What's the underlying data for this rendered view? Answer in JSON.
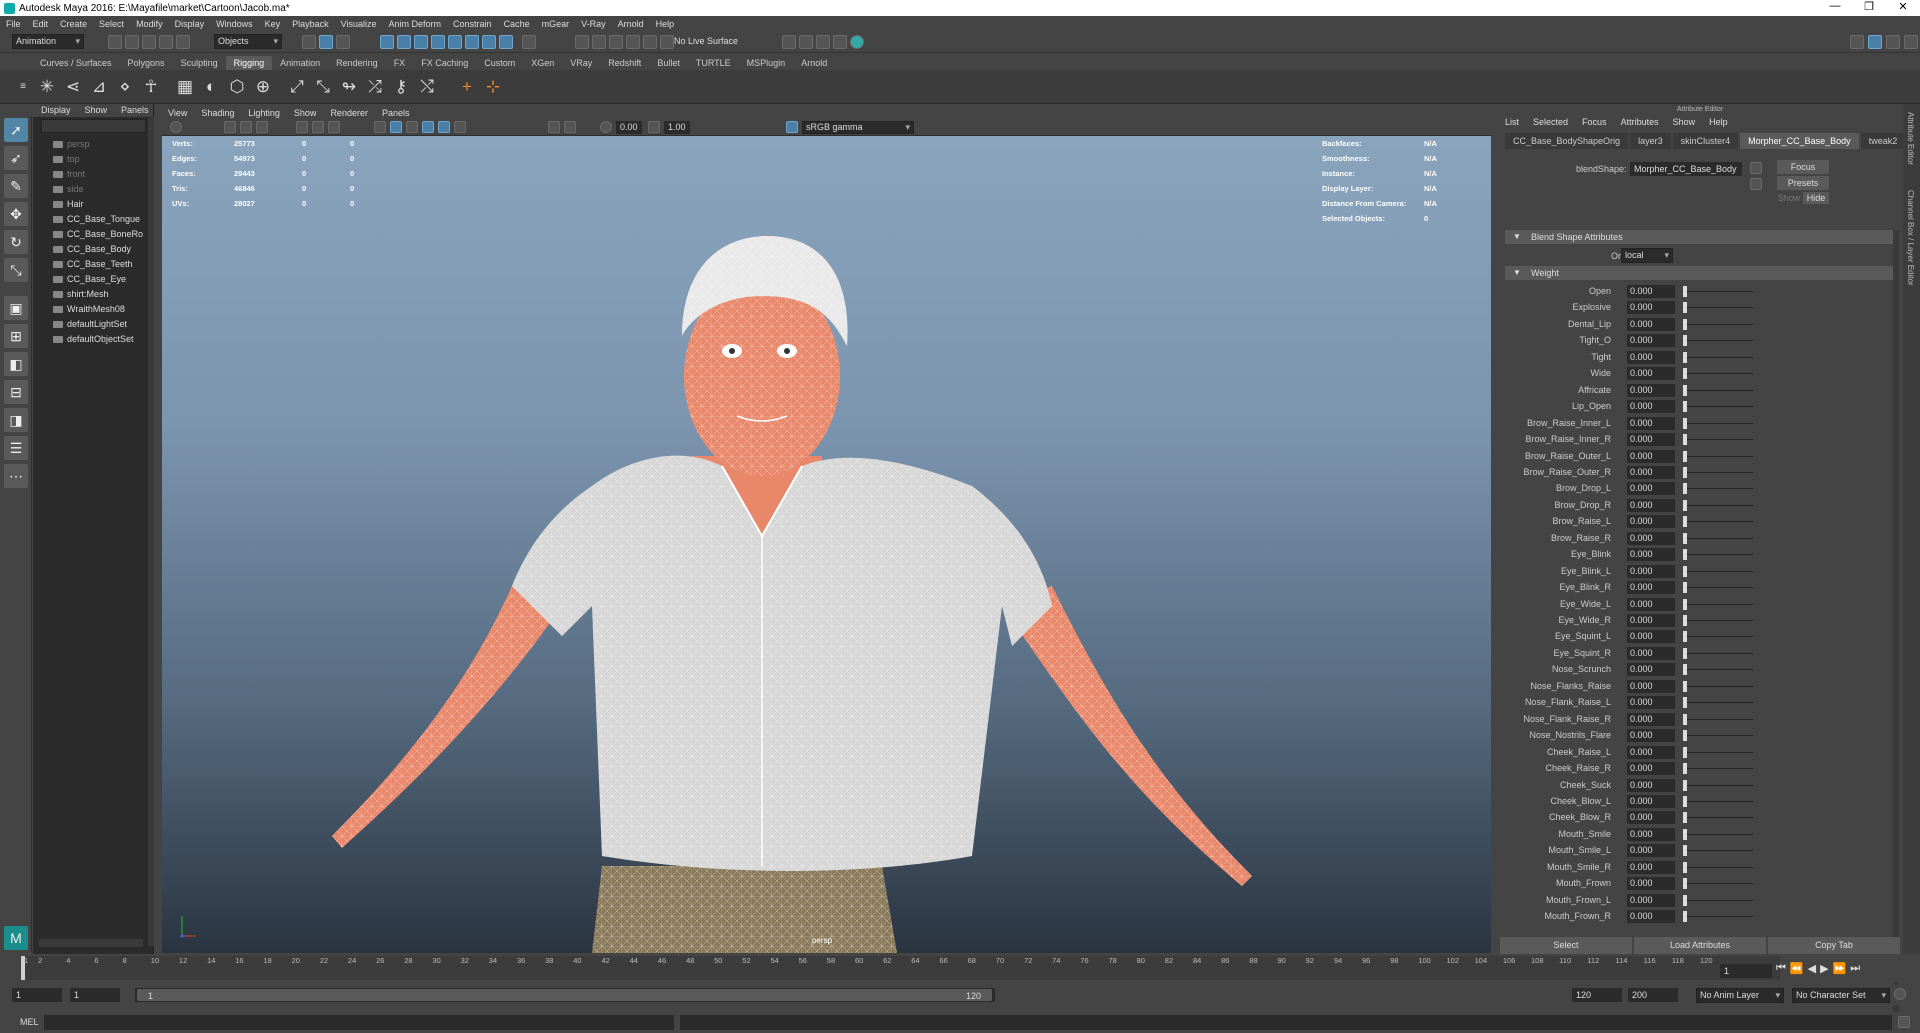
{
  "window": {
    "title": "Autodesk Maya 2016: E:\\Mayafile\\market\\Cartoon\\Jacob.ma*",
    "controls": [
      "—",
      "❐",
      "✕"
    ]
  },
  "menubar": [
    "File",
    "Edit",
    "Create",
    "Select",
    "Modify",
    "Display",
    "Windows",
    "Key",
    "Playback",
    "Visualize",
    "Anim Deform",
    "Constrain",
    "Cache",
    "mGear",
    "V-Ray",
    "Arnold",
    "Help"
  ],
  "statusline": {
    "menuset": "Animation",
    "objects": "Objects",
    "live_surface": "No Live Surface"
  },
  "shelf_tabs": [
    "Curves / Surfaces",
    "Polygons",
    "Sculpting",
    "Rigging",
    "Animation",
    "Rendering",
    "FX",
    "FX Caching",
    "Custom",
    "XGen",
    "VRay",
    "Redshift",
    "Bullet",
    "TURTLE",
    "MSPlugin",
    "Arnold"
  ],
  "shelf_active": "Rigging",
  "outliner": {
    "menu": [
      "Display",
      "Show",
      "Panels"
    ],
    "items": [
      {
        "label": "persp",
        "dim": true
      },
      {
        "label": "top",
        "dim": true
      },
      {
        "label": "front",
        "dim": true
      },
      {
        "label": "side",
        "dim": true
      },
      {
        "label": "Hair",
        "dim": false
      },
      {
        "label": "CC_Base_Tongue",
        "dim": false
      },
      {
        "label": "CC_Base_BoneRo",
        "dim": false
      },
      {
        "label": "CC_Base_Body",
        "dim": false
      },
      {
        "label": "CC_Base_Teeth",
        "dim": false
      },
      {
        "label": "CC_Base_Eye",
        "dim": false
      },
      {
        "label": "shirt:Mesh",
        "dim": false
      },
      {
        "label": "WraithMesh08",
        "dim": false
      },
      {
        "label": "defaultLightSet",
        "dim": false
      },
      {
        "label": "defaultObjectSet",
        "dim": false
      }
    ]
  },
  "viewport": {
    "menu": [
      "View",
      "Shading",
      "Lighting",
      "Show",
      "Renderer",
      "Panels"
    ],
    "exposure": "0.00",
    "gamma": "1.00",
    "colorspace": "sRGB gamma",
    "camera_label": "persp",
    "stats": [
      {
        "label": "Verts:",
        "a": "25773",
        "b": "0",
        "c": "0"
      },
      {
        "label": "Edges:",
        "a": "54973",
        "b": "0",
        "c": "0"
      },
      {
        "label": "Faces:",
        "a": "29443",
        "b": "0",
        "c": "0"
      },
      {
        "label": "Tris:",
        "a": "46846",
        "b": "0",
        "c": "0"
      },
      {
        "label": "UVs:",
        "a": "28027",
        "b": "0",
        "c": "0"
      }
    ],
    "stats_right": [
      {
        "label": "Backfaces:",
        "val": "N/A"
      },
      {
        "label": "Smoothness:",
        "val": "N/A"
      },
      {
        "label": "Instance:",
        "val": "N/A"
      },
      {
        "label": "Display Layer:",
        "val": "N/A"
      },
      {
        "label": "Distance From Camera:",
        "val": "N/A"
      },
      {
        "label": "Selected Objects:",
        "val": "0"
      }
    ]
  },
  "attr_editor": {
    "title": "Attribute Editor",
    "menu": [
      "List",
      "Selected",
      "Focus",
      "Attributes",
      "Show",
      "Help"
    ],
    "tabs": [
      "CC_Base_BodyShapeOrig",
      "layer3",
      "skinCluster4",
      "Morpher_CC_Base_Body",
      "tweak2"
    ],
    "active_tab": "Morpher_CC_Base_Body",
    "blendshape_label": "blendShape:",
    "blendshape_value": "Morpher_CC_Base_Body",
    "side_buttons": [
      "Focus",
      "Presets",
      "Show",
      "Hide"
    ],
    "section1": "Blend Shape Attributes",
    "origin_label": "Origin",
    "origin_value": "local",
    "section2": "Weight",
    "weights": [
      {
        "name": "Open",
        "value": "0.000"
      },
      {
        "name": "Explosive",
        "value": "0.000"
      },
      {
        "name": "Dental_Lip",
        "value": "0.000"
      },
      {
        "name": "Tight_O",
        "value": "0.000"
      },
      {
        "name": "Tight",
        "value": "0.000"
      },
      {
        "name": "Wide",
        "value": "0.000"
      },
      {
        "name": "Affricate",
        "value": "0.000"
      },
      {
        "name": "Lip_Open",
        "value": "0.000"
      },
      {
        "name": "Brow_Raise_Inner_L",
        "value": "0.000"
      },
      {
        "name": "Brow_Raise_Inner_R",
        "value": "0.000"
      },
      {
        "name": "Brow_Raise_Outer_L",
        "value": "0.000"
      },
      {
        "name": "Brow_Raise_Outer_R",
        "value": "0.000"
      },
      {
        "name": "Brow_Drop_L",
        "value": "0.000"
      },
      {
        "name": "Brow_Drop_R",
        "value": "0.000"
      },
      {
        "name": "Brow_Raise_L",
        "value": "0.000"
      },
      {
        "name": "Brow_Raise_R",
        "value": "0.000"
      },
      {
        "name": "Eye_Blink",
        "value": "0.000"
      },
      {
        "name": "Eye_Blink_L",
        "value": "0.000"
      },
      {
        "name": "Eye_Blink_R",
        "value": "0.000"
      },
      {
        "name": "Eye_Wide_L",
        "value": "0.000"
      },
      {
        "name": "Eye_Wide_R",
        "value": "0.000"
      },
      {
        "name": "Eye_Squint_L",
        "value": "0.000"
      },
      {
        "name": "Eye_Squint_R",
        "value": "0.000"
      },
      {
        "name": "Nose_Scrunch",
        "value": "0.000"
      },
      {
        "name": "Nose_Flanks_Raise",
        "value": "0.000"
      },
      {
        "name": "Nose_Flank_Raise_L",
        "value": "0.000"
      },
      {
        "name": "Nose_Flank_Raise_R",
        "value": "0.000"
      },
      {
        "name": "Nose_Nostrils_Flare",
        "value": "0.000"
      },
      {
        "name": "Cheek_Raise_L",
        "value": "0.000"
      },
      {
        "name": "Cheek_Raise_R",
        "value": "0.000"
      },
      {
        "name": "Cheek_Suck",
        "value": "0.000"
      },
      {
        "name": "Cheek_Blow_L",
        "value": "0.000"
      },
      {
        "name": "Cheek_Blow_R",
        "value": "0.000"
      },
      {
        "name": "Mouth_Smile",
        "value": "0.000"
      },
      {
        "name": "Mouth_Smile_L",
        "value": "0.000"
      },
      {
        "name": "Mouth_Smile_R",
        "value": "0.000"
      },
      {
        "name": "Mouth_Frown",
        "value": "0.000"
      },
      {
        "name": "Mouth_Frown_L",
        "value": "0.000"
      },
      {
        "name": "Mouth_Frown_R",
        "value": "0.000"
      }
    ],
    "bottom_buttons": [
      "Select",
      "Load Attributes",
      "Copy Tab"
    ],
    "side_tabs": [
      "Attribute Editor",
      "Channel Box / Layer Editor"
    ]
  },
  "timeline": {
    "ticks": [
      "1",
      "2",
      "4",
      "6",
      "8",
      "10",
      "12",
      "14",
      "16",
      "18",
      "20",
      "22",
      "24",
      "26",
      "28",
      "30",
      "32",
      "34",
      "36",
      "38",
      "40",
      "42",
      "44",
      "46",
      "48",
      "50",
      "52",
      "54",
      "56",
      "58",
      "60",
      "62",
      "64",
      "66",
      "68",
      "70",
      "72",
      "74",
      "76",
      "78",
      "80",
      "82",
      "84",
      "86",
      "88",
      "90",
      "92",
      "94",
      "96",
      "98",
      "100",
      "102",
      "104",
      "106",
      "108",
      "110",
      "112",
      "114",
      "116",
      "118",
      "120"
    ],
    "current_frame": "1"
  },
  "range": {
    "start": "1",
    "anim_start": "1",
    "slider_start": "1",
    "slider_end": "120",
    "end": "120",
    "anim_end": "200",
    "anim_layer": "No Anim Layer",
    "character_set": "No Character Set"
  },
  "cmdline": {
    "lang": "MEL"
  },
  "colors": {
    "accent": "#5285a6",
    "skin": "#e8876a",
    "shirt": "#d6d6d6",
    "pants": "#8a7a5a"
  }
}
